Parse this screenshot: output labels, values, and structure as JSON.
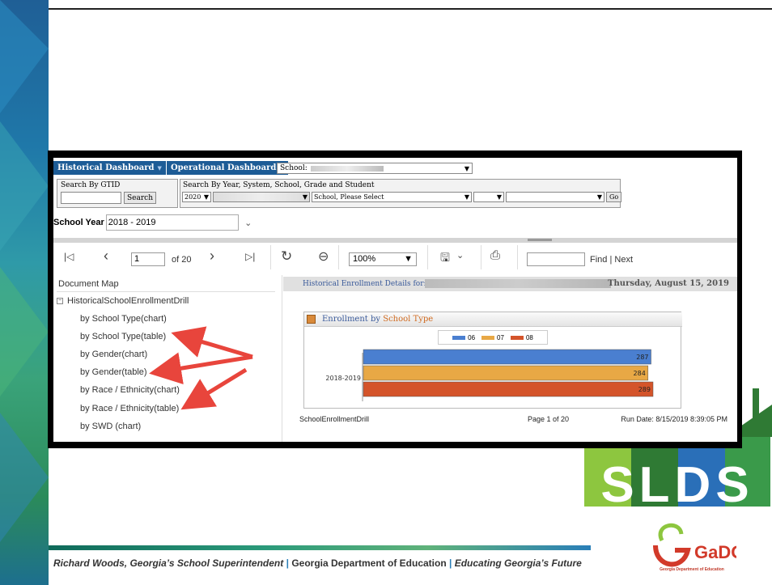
{
  "nav": {
    "tab1": "Historical Dashboard",
    "tab2": "Operational Dashboard",
    "school_label": "School:"
  },
  "search_gtid": {
    "label": "Search By GTID",
    "button": "Search"
  },
  "search_multi": {
    "label": "Search By Year, System, School, Grade and Student",
    "year_value": "2020",
    "school_placeholder": "School, Please Select",
    "go_button": "Go"
  },
  "school_year": {
    "label": "School Year",
    "value": "2018 - 2019"
  },
  "toolbar": {
    "page_value": "1",
    "page_of": "of 20",
    "zoom": "100%",
    "find_link": "Find",
    "next_link": "Next",
    "separator": "|"
  },
  "document_map": {
    "title": "Document Map",
    "root": "HistoricalSchoolEnrollmentDrill",
    "items": [
      "by School Type(chart)",
      "by School Type(table)",
      "by Gender(chart)",
      "by Gender(table)",
      "by Race / Ethnicity(chart)",
      "by Race / Ethnicity(table)",
      "by SWD (chart)"
    ]
  },
  "report": {
    "header_label": "Historical Enrollment Details for:",
    "date": "Thursday, August 15, 2019",
    "chart_title_prefix": "Enrollment by",
    "chart_title_highlight": "School Type",
    "footer_left": "SchoolEnrollmentDrill",
    "footer_mid": "Page 1 of 20",
    "footer_right": "Run Date: 8/15/2019 8:39:05 PM"
  },
  "chart_data": {
    "type": "bar",
    "orientation": "horizontal",
    "categories": [
      "2018-2019"
    ],
    "series": [
      {
        "name": "06",
        "values": [
          287
        ],
        "color": "#4a7fd0"
      },
      {
        "name": "07",
        "values": [
          284
        ],
        "color": "#e8a845"
      },
      {
        "name": "08",
        "values": [
          289
        ],
        "color": "#d4542a"
      }
    ]
  },
  "footer": {
    "part1": "Richard Woods, Georgia’s School Superintendent",
    "sep": "|",
    "part2": "Georgia Department of Education",
    "part3": "Educating Georgia’s Future"
  },
  "logos": {
    "slds": "SLDS",
    "gadoe": "GaDOE",
    "gadoe_caption": "Georgia Department of Education"
  }
}
